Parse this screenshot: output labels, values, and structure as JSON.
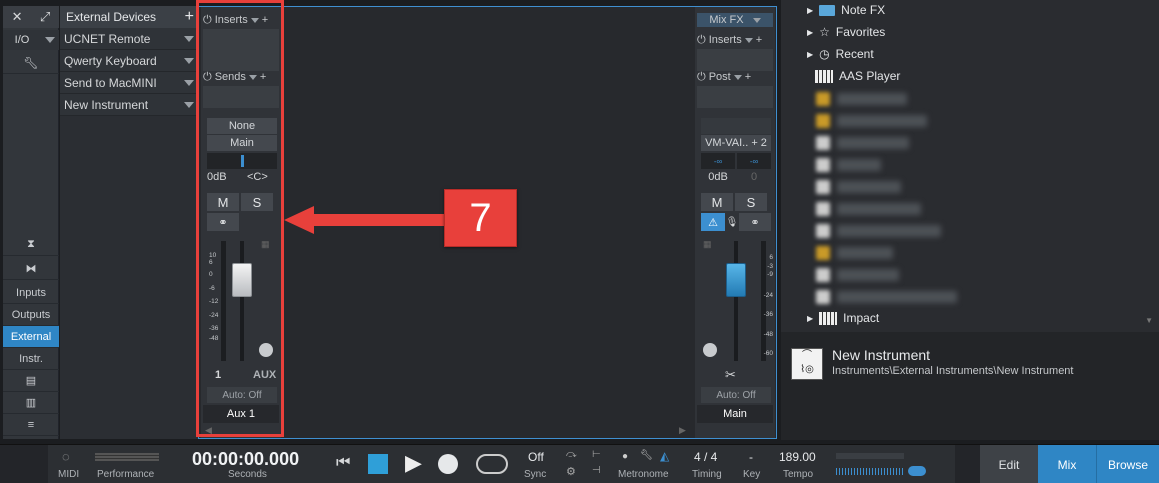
{
  "left_rail": {
    "io_label": "I/O",
    "buttons": [
      "Inputs",
      "Outputs",
      "External",
      "Instr."
    ],
    "active_button": "External"
  },
  "device_list": {
    "header": "External Devices",
    "items": [
      "UCNET Remote",
      "Qwerty Keyboard",
      "Send to MacMINI",
      "New Instrument"
    ]
  },
  "aux_channel": {
    "inserts_label": "Inserts",
    "sends_label": "Sends",
    "input": "None",
    "output": "Main",
    "volume": "0dB",
    "pan": "<C>",
    "mute": "M",
    "solo": "S",
    "scale": [
      "10",
      "6",
      "0",
      "-6",
      "-12",
      "-24",
      "-36",
      "-48"
    ],
    "number": "1",
    "type": "AUX",
    "automation": "Auto: Off",
    "name": "Aux 1",
    "fader_level": 0.82
  },
  "main_channel": {
    "mix_fx_label": "Mix FX",
    "inserts_label": "Inserts",
    "post_label": "Post",
    "output": "VM-VAI.. + 2",
    "peak_left": "-∞",
    "peak_right": "-∞",
    "volume": "0dB",
    "pan": "0",
    "mute": "M",
    "solo": "S",
    "scale": [
      "6",
      "-3",
      "-9",
      "-24",
      "-36",
      "-48",
      "-60"
    ],
    "automation": "Auto: Off",
    "name": "Main",
    "fader_level": 0.82
  },
  "callout": {
    "number": "7",
    "color": "#e8403b"
  },
  "browser": {
    "items": [
      {
        "label": "Note FX",
        "icon": "folder-icon"
      },
      {
        "label": "Favorites",
        "icon": "star-icon"
      },
      {
        "label": "Recent",
        "icon": "clock-icon"
      },
      {
        "label": "AAS Player",
        "icon": "keyboard-icon"
      },
      {
        "label": "Impact",
        "icon": "keyboard-icon"
      }
    ],
    "selected_title": "New Instrument",
    "selected_path": "Instruments\\External Instruments\\New Instrument"
  },
  "transport": {
    "midi_label": "MIDI",
    "performance_label": "Performance",
    "time": "00:00:00.000",
    "time_unit": "Seconds",
    "sync_value": "Off",
    "sync_label": "Sync",
    "metronome_label": "Metronome",
    "timing_value": "4 / 4",
    "timing_label": "Timing",
    "key_value": "-",
    "key_label": "Key",
    "tempo_value": "189.00",
    "tempo_label": "Tempo",
    "tabs": [
      "Edit",
      "Mix",
      "Browse"
    ],
    "active_tab": "Mix"
  },
  "colors": {
    "accent": "#2f86c5",
    "callout": "#e8403b",
    "selection_blue": "#3c8fd0"
  }
}
